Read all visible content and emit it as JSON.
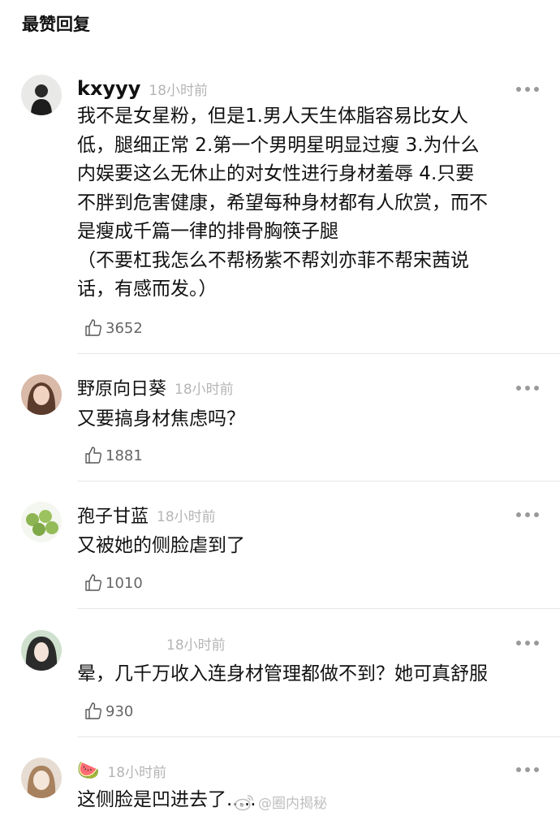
{
  "section_title": "最赞回复",
  "comments": [
    {
      "username": "kxyyy",
      "time": "18小时前",
      "text": "我不是女星粉，但是1.男人天生体脂容易比女人\n低，腿细正常 2.第一个男明星明显过瘦 3.为什么\n内娱要这么无休止的对女性进行身材羞辱 4.只要\n不胖到危害健康，希望每种身材都有人欣赏，而不\n是瘦成千篇一律的排骨胸筷子腿\n（不要杠我怎么不帮杨紫不帮刘亦菲不帮宋茜说\n话，有感而发。）",
      "likes": "3652"
    },
    {
      "username": "野原向日葵",
      "time": "18小时前",
      "text": "又要搞身材焦虑吗？",
      "likes": "1881"
    },
    {
      "username": "孢子甘蓝",
      "time": "18小时前",
      "text": "又被她的侧脸虐到了",
      "likes": "1010"
    },
    {
      "username": "",
      "time": "18小时前",
      "text": "晕，几千万收入连身材管理都做不到？她可真舒服",
      "likes": "930"
    },
    {
      "username": "🍉",
      "time": "18小时前",
      "text": "这侧脸是凹进去了....."
    }
  ],
  "watermark": "@圈内揭秘",
  "icons": {
    "like": "thumbs-up-icon",
    "more": "more-dots-icon",
    "watermark": "weibo-logo-icon"
  },
  "colors": {
    "text": "#111111",
    "time": "#b5b5b5",
    "likes": "#666666",
    "divider": "#e7e7e7"
  }
}
